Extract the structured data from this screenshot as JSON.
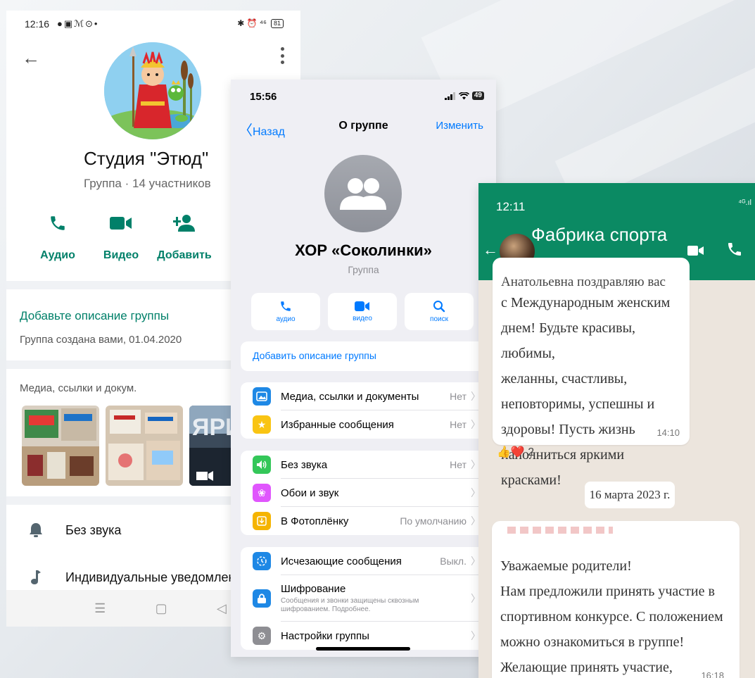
{
  "screen1": {
    "status": {
      "time": "12:16",
      "left_icons": "●▣ℳ⊙•",
      "right_icons": "✱ ⏰ ⁴⁶",
      "battery": "81"
    },
    "title": "Студия \"Этюд\"",
    "subtitle": "Группа · 14 участников",
    "actions": [
      {
        "label": "Аудио",
        "icon": "phone-icon"
      },
      {
        "label": "Видео",
        "icon": "video-icon"
      },
      {
        "label": "Добавить",
        "icon": "add-person-icon"
      }
    ],
    "add_description": "Добавьте описание группы",
    "created": "Группа создана вами, 01.04.2020",
    "media_header": "Медиа, ссылки и докум.",
    "rows": [
      {
        "label": "Без звука",
        "icon": "bell-icon"
      },
      {
        "label": "Индивидуальные уведомления",
        "icon": "music-note-icon"
      }
    ],
    "accent_color": "#008069"
  },
  "screen2": {
    "status": {
      "time": "15:56",
      "battery": "49"
    },
    "nav": {
      "back": "Назад",
      "title": "О группе",
      "edit": "Изменить"
    },
    "group_name": "ХОР «Соколинки»",
    "group_type": "Группа",
    "buttons": [
      {
        "label": "аудио",
        "icon": "phone-icon"
      },
      {
        "label": "видео",
        "icon": "video-icon"
      },
      {
        "label": "поиск",
        "icon": "search-icon"
      }
    ],
    "add_description": "Добавить описание группы",
    "section1": [
      {
        "label": "Медиа, ссылки и документы",
        "value": "Нет",
        "color": "#1e88e5",
        "icon": "image-icon"
      },
      {
        "label": "Избранные сообщения",
        "value": "Нет",
        "color": "#f9c413",
        "icon": "star-icon"
      }
    ],
    "section2": [
      {
        "label": "Без звука",
        "value": "Нет",
        "color": "#34c759",
        "icon": "speaker-icon"
      },
      {
        "label": "Обои и звук",
        "value": "",
        "color": "#e056fd",
        "icon": "flower-icon"
      },
      {
        "label": "В Фотоплёнку",
        "value": "По умолчанию",
        "color": "#f5b400",
        "icon": "download-icon"
      }
    ],
    "section3": [
      {
        "label": "Исчезающие сообщения",
        "value": "Выкл.",
        "color": "#1e88e5",
        "icon": "timer-icon"
      },
      {
        "label": "Шифрование",
        "sub": "Сообщения и звонки защищены сквозным шифрованием. Подробнее.",
        "value": "",
        "color": "#1e88e5",
        "icon": "lock-icon"
      },
      {
        "label": "Настройки группы",
        "value": "",
        "color": "#8e8e93",
        "icon": "gear-icon"
      }
    ],
    "accent_color": "#007aff"
  },
  "screen3": {
    "time": "12:11",
    "signal": "⁴ᴳ.ıl",
    "chat_name": "Фабрика спорта",
    "message1_clip": "Анатольевна поздравляю вас",
    "message1": "с Международным женским\nднем! Будьте красивы, любимы,\nжеланны, счастливы,\nнеповторимы, успешны и\nздоровы! Пусть жизнь\nнаполниться яркими красками!",
    "message1_time": "14:10",
    "reactions": "👍❤️ 2",
    "date": "16 марта 2023 г.",
    "message2": "Уважаемые родители!\nНам предложили принять участие в\nспортивном конкурсе. С положением\nможно ознакомиться в группе!\nЖелающие принять участие,\nсообщите мне.",
    "message2_time": "16:18",
    "header_color": "#0b8a63"
  }
}
